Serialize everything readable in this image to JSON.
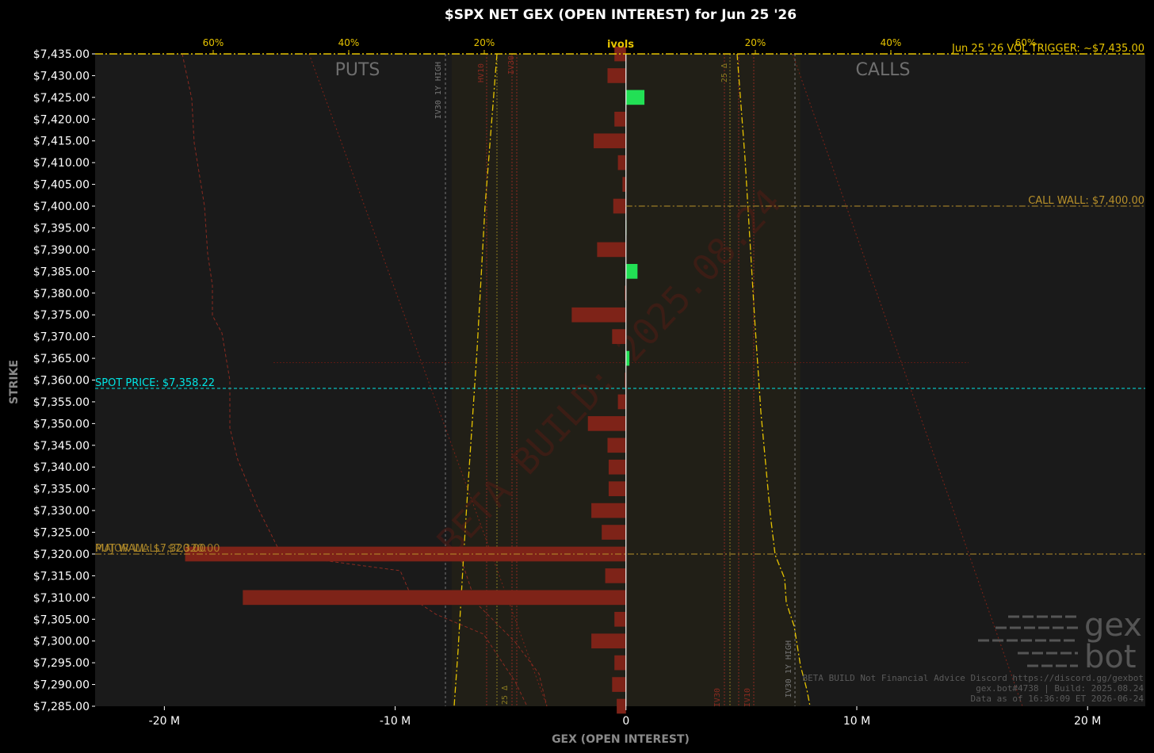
{
  "chart_data": {
    "type": "bar",
    "orientation": "horizontal",
    "title": "$SPX NET GEX (OPEN INTEREST) for Jun 25 '26",
    "xlabel": "GEX (OPEN INTEREST)",
    "ylabel": "STRIKE",
    "xlim": [
      -23,
      22.5
    ],
    "ylim": [
      7285,
      7435
    ],
    "x_ticks": [
      {
        "value": -20,
        "label": "-20 M"
      },
      {
        "value": -10,
        "label": "-10 M"
      },
      {
        "value": 0,
        "label": "0"
      },
      {
        "value": 10,
        "label": "10 M"
      },
      {
        "value": 20,
        "label": "20 M"
      }
    ],
    "y_ticks": [
      "$7,435.00",
      "$7,430.00",
      "$7,425.00",
      "$7,420.00",
      "$7,415.00",
      "$7,410.00",
      "$7,405.00",
      "$7,400.00",
      "$7,395.00",
      "$7,390.00",
      "$7,385.00",
      "$7,380.00",
      "$7,375.00",
      "$7,370.00",
      "$7,365.00",
      "$7,360.00",
      "$7,355.00",
      "$7,350.00",
      "$7,345.00",
      "$7,340.00",
      "$7,335.00",
      "$7,330.00",
      "$7,325.00",
      "$7,320.00",
      "$7,315.00",
      "$7,310.00",
      "$7,305.00",
      "$7,300.00",
      "$7,295.00",
      "$7,290.00",
      "$7,285.00"
    ],
    "strikes": [
      7435,
      7430,
      7425,
      7420,
      7415,
      7410,
      7405,
      7400,
      7395,
      7390,
      7385,
      7380,
      7375,
      7370,
      7365,
      7360,
      7355,
      7350,
      7345,
      7340,
      7335,
      7330,
      7325,
      7320,
      7315,
      7310,
      7305,
      7300,
      7295,
      7290,
      7285
    ],
    "values": [
      -0.5,
      -0.8,
      0.8,
      -0.5,
      -1.4,
      -0.35,
      -0.15,
      -0.55,
      0,
      -1.25,
      0.5,
      -0.05,
      -2.35,
      -0.6,
      0.15,
      -0.05,
      -0.35,
      -1.65,
      -0.8,
      -0.75,
      -0.75,
      -1.5,
      -1.05,
      -19.1,
      -0.9,
      -16.6,
      -0.5,
      -1.5,
      -0.5,
      -0.6,
      -0.4
    ],
    "colors": {
      "positive": "#22e055",
      "negative": "#7e2318",
      "zero_line": "#ffffff"
    },
    "ivols": {
      "label": "ivols",
      "ticks_left": [
        "60%",
        "40%",
        "20%"
      ],
      "ticks_right": [
        "20%",
        "40%",
        "60%"
      ]
    },
    "sides": {
      "left": "PUTS",
      "right": "CALLS"
    },
    "levels": [
      {
        "name": "vol_trigger",
        "label": "Jun 25 '26 VOL TRIGGER: ~$7,435.00",
        "value": 7435,
        "color": "#e6c300"
      },
      {
        "name": "call_wall",
        "label": "CALL WALL: $7,400.00",
        "value": 7400,
        "color": "#b8902a"
      },
      {
        "name": "spot",
        "label": "SPOT PRICE: $7,358.22",
        "value": 7358.22,
        "color": "#00e5e5"
      },
      {
        "name": "put_wall",
        "label": "PUT WALL: $7,320.00",
        "value": 7320,
        "color": "#b8902a"
      },
      {
        "name": "major_wall",
        "label": "MAJOR WALL: $7,320.00",
        "value": 7320,
        "color": "#b8902a"
      }
    ],
    "vertical_labels": [
      "IV30 1Y HIGH",
      "HV10",
      "IV30",
      "25 Δ",
      "25 Δ",
      "IV30",
      "IV10",
      "IV30 1Y HIGH"
    ],
    "watermark": "BETA BUILD: 2025.08.24",
    "footer": [
      "BETA BUILD Not Financial Advice Discord https://discord.gg/gexbot",
      "gex.bot#4738 | Build: 2025.08.24",
      "Data as of 16:36:09 ET 2026-06-24"
    ],
    "logo": [
      "gex",
      "bot"
    ]
  }
}
